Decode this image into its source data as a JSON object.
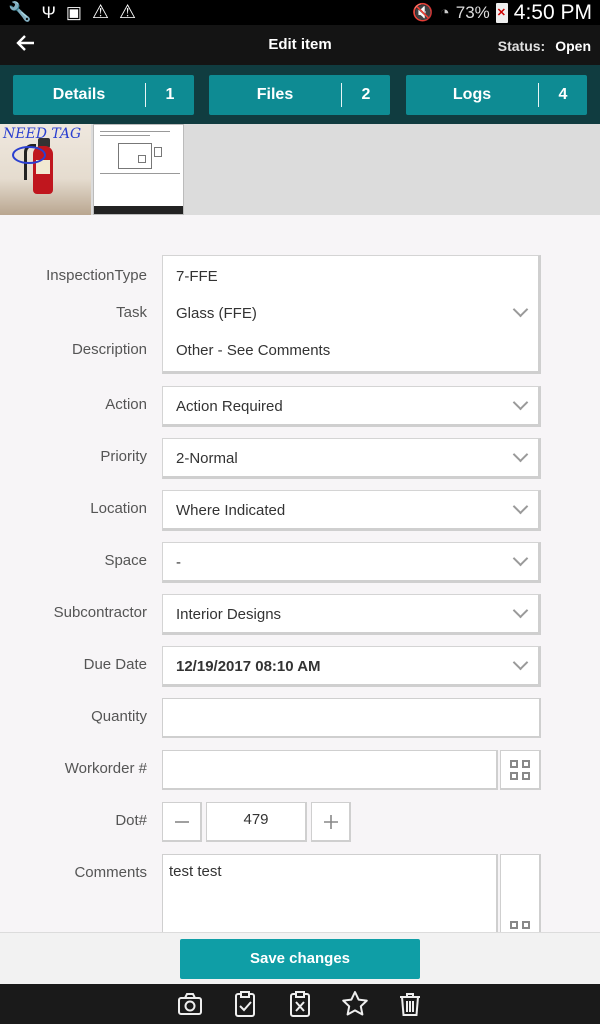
{
  "status_bar": {
    "battery_percent": "73%",
    "time": "4:50 PM"
  },
  "header": {
    "title": "Edit item",
    "status_label": "Status:",
    "status_value": "Open",
    "back_icon": "arrow-left-icon"
  },
  "tabs": [
    {
      "label": "Details",
      "count": "1"
    },
    {
      "label": "Files",
      "count": "2"
    },
    {
      "label": "Logs",
      "count": "4"
    }
  ],
  "thumbnails": {
    "photo_annotation": "NEED TAG"
  },
  "form": {
    "inspection_type_label": "InspectionType",
    "inspection_type_value": "7-FFE",
    "task_label": "Task",
    "task_value": "Glass (FFE)",
    "description_label": "Description",
    "description_value": "Other - See Comments",
    "action_label": "Action",
    "action_value": "Action Required",
    "priority_label": "Priority",
    "priority_value": "2-Normal",
    "location_label": "Location",
    "location_value": "Where Indicated",
    "space_label": "Space",
    "space_value": "-",
    "subcontractor_label": "Subcontractor",
    "subcontractor_value": "Interior Designs",
    "due_date_label": "Due Date",
    "due_date_value": "12/19/2017 08:10 AM",
    "quantity_label": "Quantity",
    "quantity_value": "",
    "workorder_label": "Workorder #",
    "workorder_value": "",
    "dot_label": "Dot#",
    "dot_value": "479",
    "comments_label": "Comments",
    "comments_value": "test test"
  },
  "footer": {
    "save_label": "Save changes",
    "toolbar_icons": [
      "camera-icon",
      "clipboard-check-icon",
      "clipboard-x-icon",
      "star-icon",
      "trash-icon"
    ]
  },
  "colors": {
    "tab_background": "#0e8b93",
    "tab_bar": "#103c40",
    "save_button": "#0f9ea6",
    "header": "#141414"
  }
}
